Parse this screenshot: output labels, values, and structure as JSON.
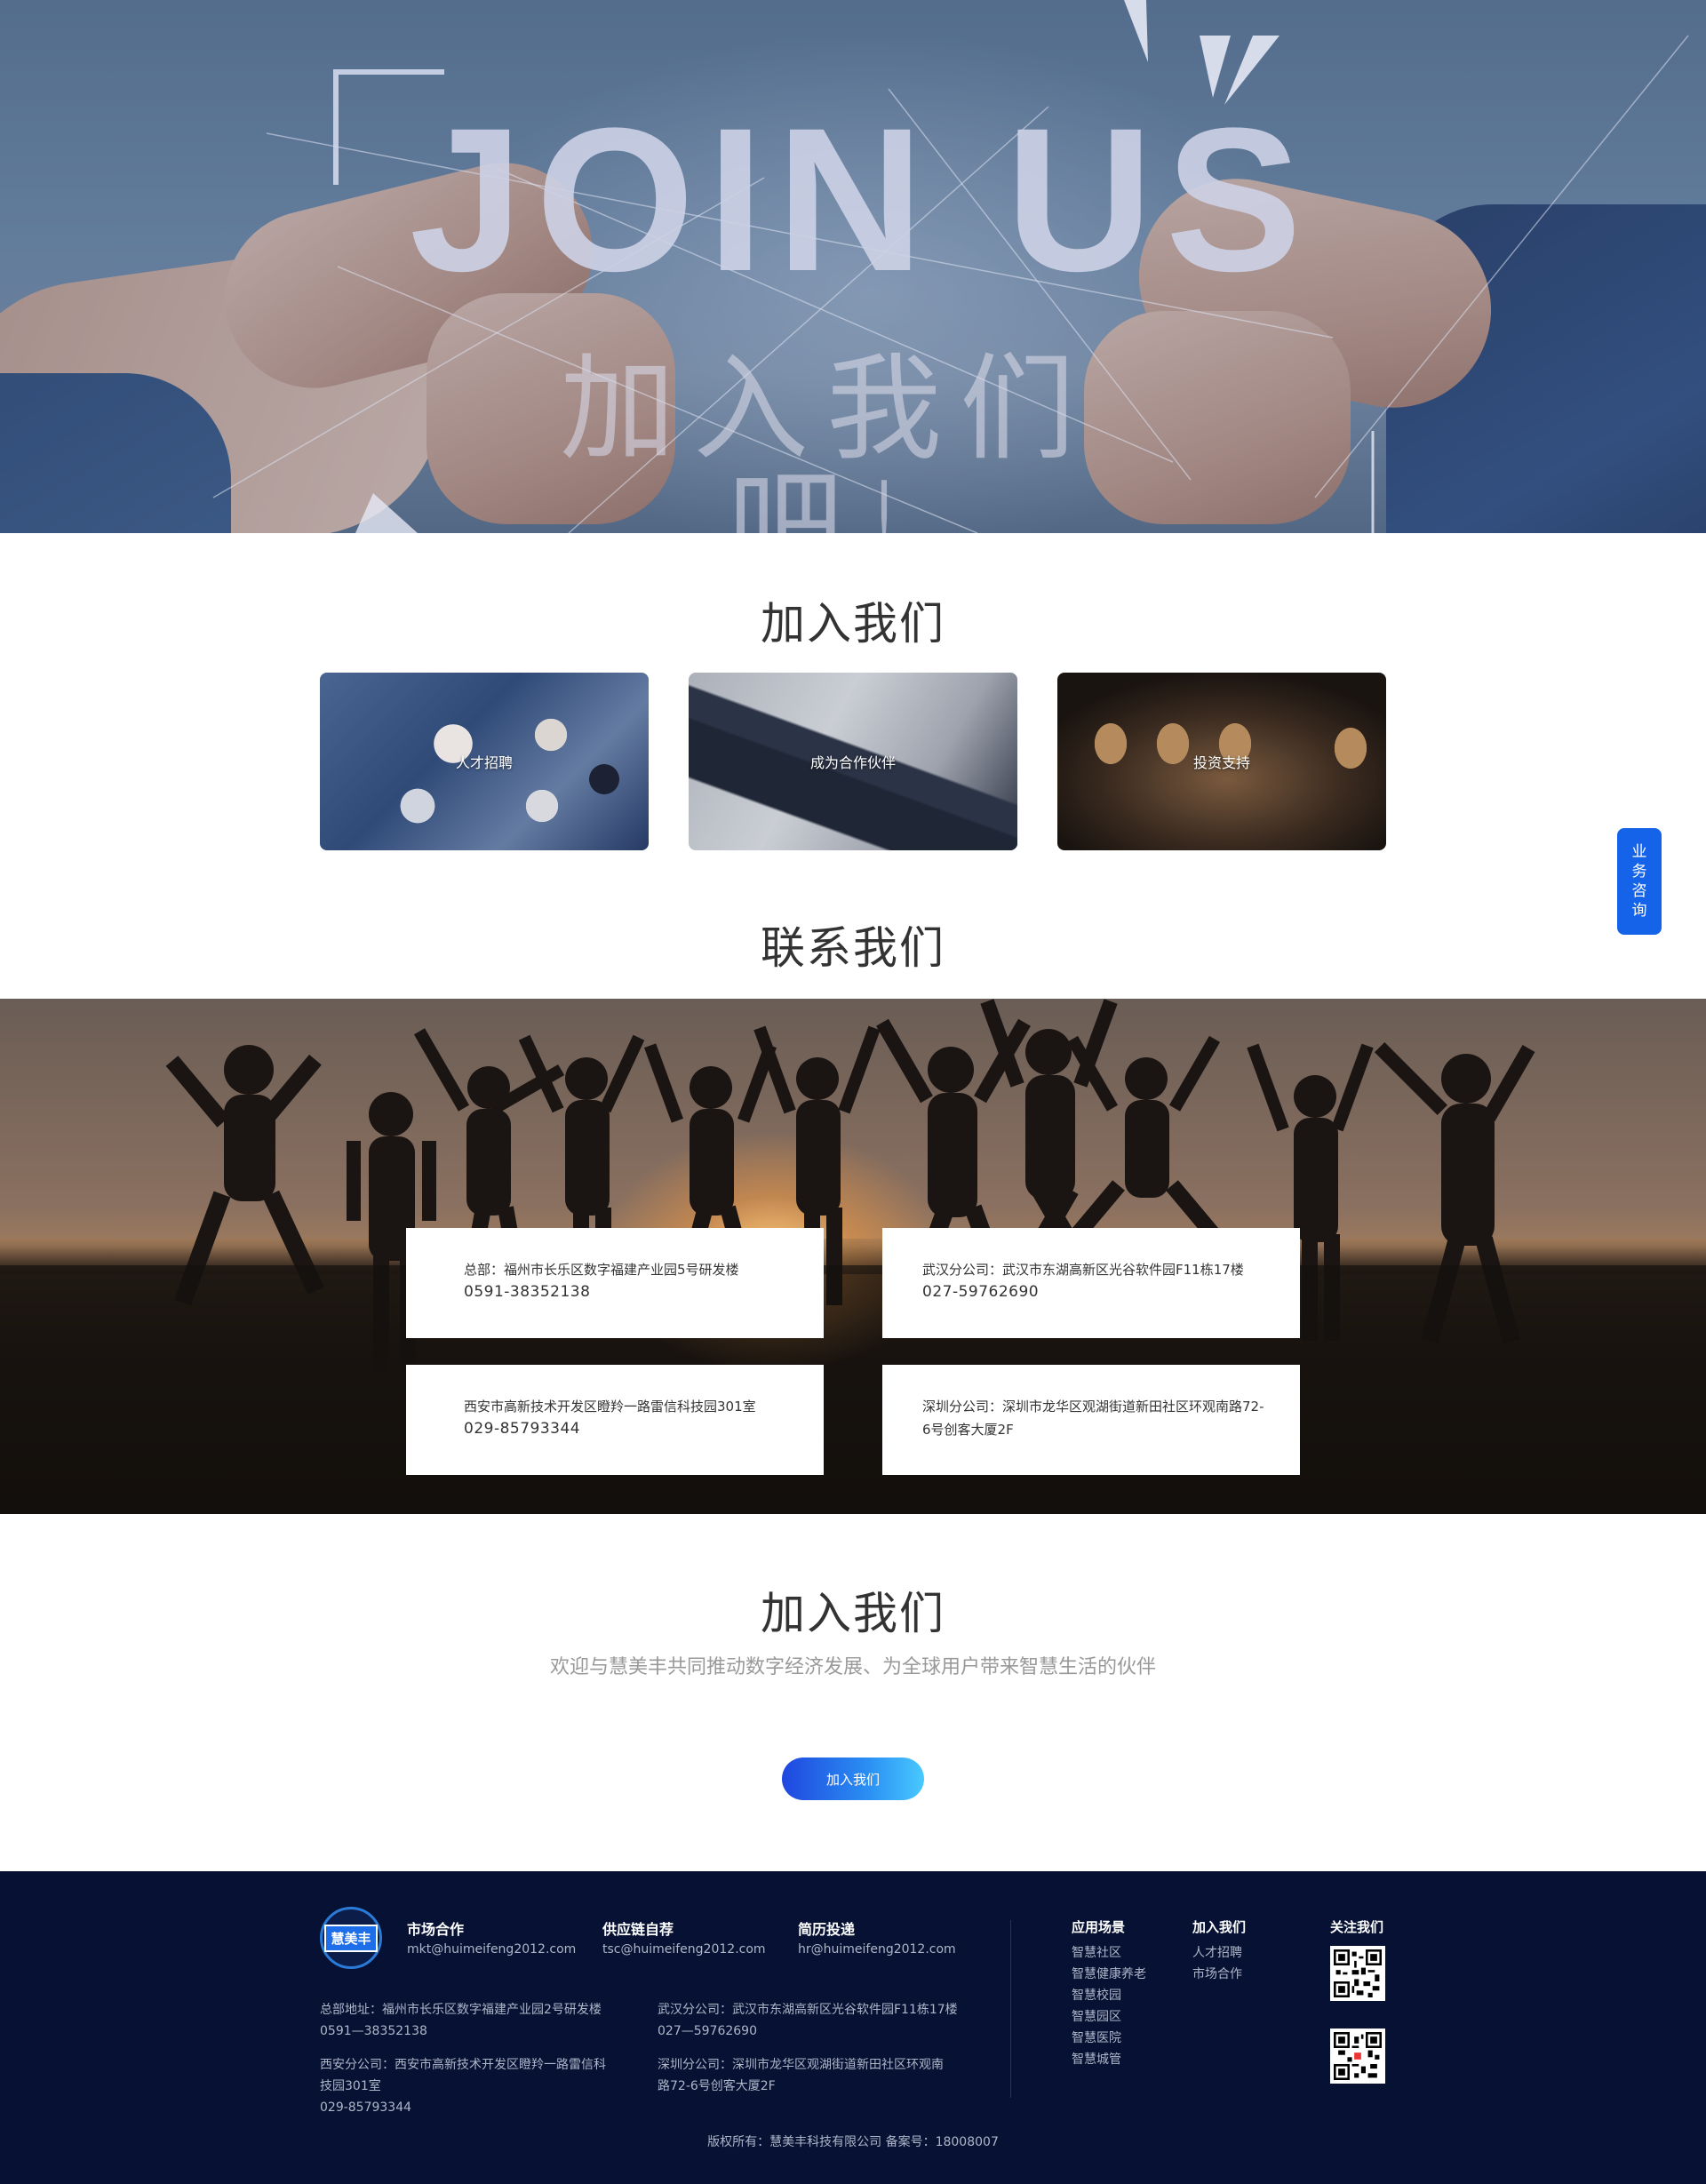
{
  "hero": {
    "title": "JOIN US",
    "subtitle": "加入我们吧!"
  },
  "join_section": {
    "title": "加入我们",
    "cards": [
      {
        "label": "人才招聘"
      },
      {
        "label": "成为合作伙伴"
      },
      {
        "label": "投资支持"
      }
    ]
  },
  "contact_section": {
    "title": "联系我们",
    "offices": [
      {
        "address": "总部：福州市长乐区数字福建产业园5号研发楼",
        "phone": "0591-38352138"
      },
      {
        "address": "武汉分公司：武汉市东湖高新区光谷软件园F11栋17楼",
        "phone": "027-59762690"
      },
      {
        "address": "西安市高新技术开发区瞪羚一路雷信科技园301室",
        "phone": "029-85793344"
      },
      {
        "address": "深圳分公司：深圳市龙华区观湖街道新田社区环观南路72-6号创客大厦2F",
        "phone": ""
      }
    ]
  },
  "cta": {
    "title": "加入我们",
    "subtitle": "欢迎与慧美丰共同推动数字经济发展、为全球用户带来智慧生活的伙伴",
    "button_label": "加入我们"
  },
  "float_consult": {
    "label": "业务咨询"
  },
  "footer": {
    "logo_text": "慧美丰",
    "contacts": [
      {
        "title": "市场合作",
        "email": "mkt@huimeifeng2012.com"
      },
      {
        "title": "供应链自荐",
        "email": "tsc@huimeifeng2012.com"
      },
      {
        "title": "简历投递",
        "email": "hr@huimeifeng2012.com"
      }
    ],
    "addresses": {
      "hq": {
        "line1": "总部地址：福州市长乐区数字福建产业园2号研发楼",
        "line2": "0591—38352138"
      },
      "xian": {
        "line1": "西安分公司：西安市高新技术开发区瞪羚一路雷信科",
        "line2": "技园301室",
        "line3": "029-85793344"
      },
      "wuhan": {
        "line1": "武汉分公司：武汉市东湖高新区光谷软件园F11栋17楼",
        "line2": "027—59762690"
      },
      "shenzhen": {
        "line1": "深圳分公司：深圳市龙华区观湖街道新田社区环观南",
        "line2": "路72-6号创客大厦2F"
      }
    },
    "scenes": {
      "title": "应用场景",
      "items": [
        "智慧社区",
        "智慧健康养老",
        "智慧校园",
        "智慧园区",
        "智慧医院",
        "智慧城管"
      ]
    },
    "join": {
      "title": "加入我们",
      "items": [
        "人才招聘",
        "市场合作"
      ]
    },
    "follow": {
      "title": "关注我们"
    },
    "copyright": "版权所有：慧美丰科技有限公司  备案号：18008007"
  }
}
